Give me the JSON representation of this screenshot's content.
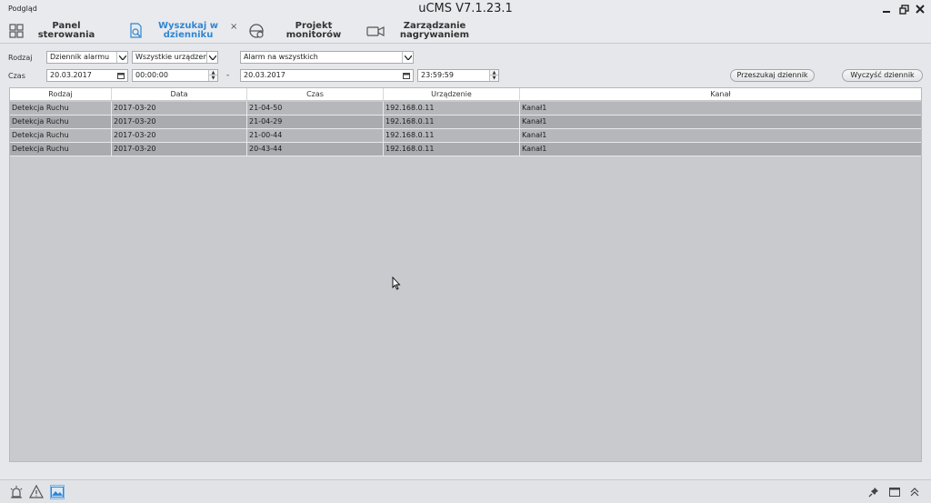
{
  "window": {
    "left_title": "Podgląd",
    "title": "uCMS V7.1.23.1"
  },
  "toolbar": {
    "items": [
      {
        "line1": "Panel",
        "line2": "sterowania",
        "icon": "grid-icon"
      },
      {
        "line1": "Wyszukaj w",
        "line2": "dzienniku",
        "icon": "search-log-icon",
        "active": true,
        "close": "×"
      },
      {
        "line1": "Projekt",
        "line2": "monitorów",
        "icon": "monitor-project-icon"
      },
      {
        "line1": "Zarządzanie",
        "line2": "nagrywaniem",
        "icon": "camera-icon"
      }
    ]
  },
  "filters": {
    "type_label": "Rodzaj",
    "time_label": "Czas",
    "log_type": "Dziennik alarmu",
    "devices": "Wszystkie urządzenia",
    "alarm": "Alarm na wszystkich",
    "start_date": "20.03.2017",
    "start_time": "00:00:00",
    "separator": "-",
    "end_date": "20.03.2017",
    "end_time": "23:59:59",
    "search_button": "Przeszukaj dziennik",
    "clear_button": "Wyczyść dziennik"
  },
  "table": {
    "columns": [
      "Rodzaj",
      "Data",
      "Czas",
      "Urządzenie",
      "Kanał"
    ],
    "rows": [
      [
        "Detekcja Ruchu",
        "2017-03-20",
        "21-04-50",
        "192.168.0.11",
        "Kanał1"
      ],
      [
        "Detekcja Ruchu",
        "2017-03-20",
        "21-04-29",
        "192.168.0.11",
        "Kanał1"
      ],
      [
        "Detekcja Ruchu",
        "2017-03-20",
        "21-00-44",
        "192.168.0.11",
        "Kanał1"
      ],
      [
        "Detekcja Ruchu",
        "2017-03-20",
        "20-43-44",
        "192.168.0.11",
        "Kanał1"
      ]
    ]
  },
  "statusbar": {
    "icons": [
      "alarm-light-icon",
      "warning-icon",
      "image-icon",
      "pin-icon",
      "window-icon",
      "collapse-icon"
    ]
  },
  "colors": {
    "accent": "#2f86d4",
    "row": "#b5b7bb",
    "row_alt": "#a9abaf",
    "grid_bg": "#c9cacd"
  }
}
